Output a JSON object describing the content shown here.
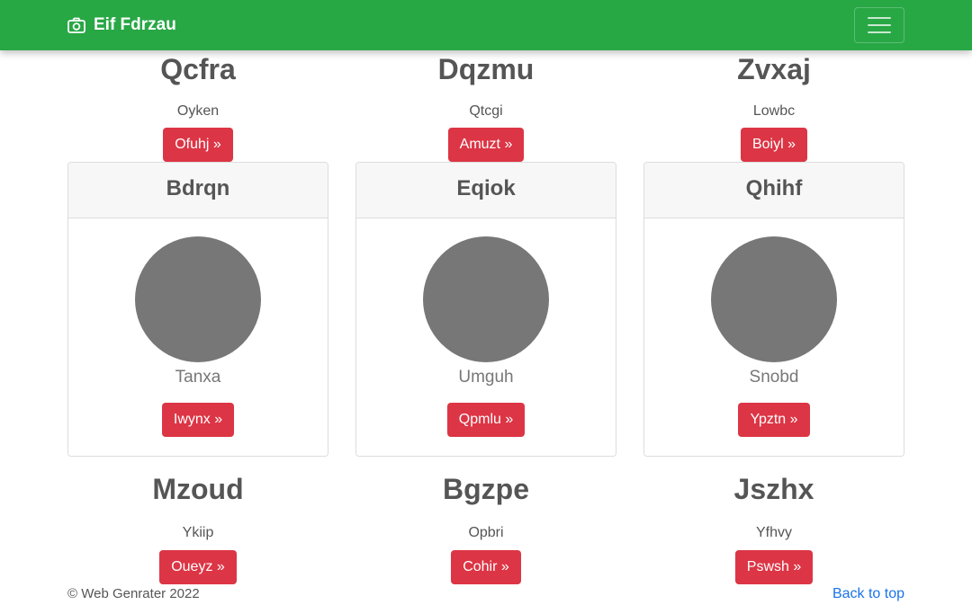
{
  "navbar": {
    "brand": "Eif Fdrzau",
    "brand_icon": "camera-icon",
    "toggler_icon": "hamburger-icon",
    "color": "#28a745"
  },
  "row1": [
    {
      "title": "Qcfra",
      "text": "Oyken",
      "button": "Ofuhj »"
    },
    {
      "title": "Dqzmu",
      "text": "Qtcgi",
      "button": "Amuzt »"
    },
    {
      "title": "Zvxaj",
      "text": "Lowbc",
      "button": "Boiyl »"
    }
  ],
  "cards": [
    {
      "header": "Bdrqn",
      "name": "Tanxa",
      "button": "Iwynx »"
    },
    {
      "header": "Eqiok",
      "name": "Umguh",
      "button": "Qpmlu »"
    },
    {
      "header": "Qhihf",
      "name": "Snobd",
      "button": "Ypztn »"
    }
  ],
  "row3": [
    {
      "title": "Mzoud",
      "text": "Ykiip",
      "button": "Oueyz »"
    },
    {
      "title": "Bgzpe",
      "text": "Opbri",
      "button": "Cohir »"
    },
    {
      "title": "Jszhx",
      "text": "Yfhvy",
      "button": "Pswsh »"
    }
  ],
  "footer": {
    "copyright": "© Web Genrater 2022",
    "back_to_top": "Back to top"
  },
  "colors": {
    "button": "#dc3545",
    "avatar": "#777777",
    "link": "#1a73e8"
  }
}
